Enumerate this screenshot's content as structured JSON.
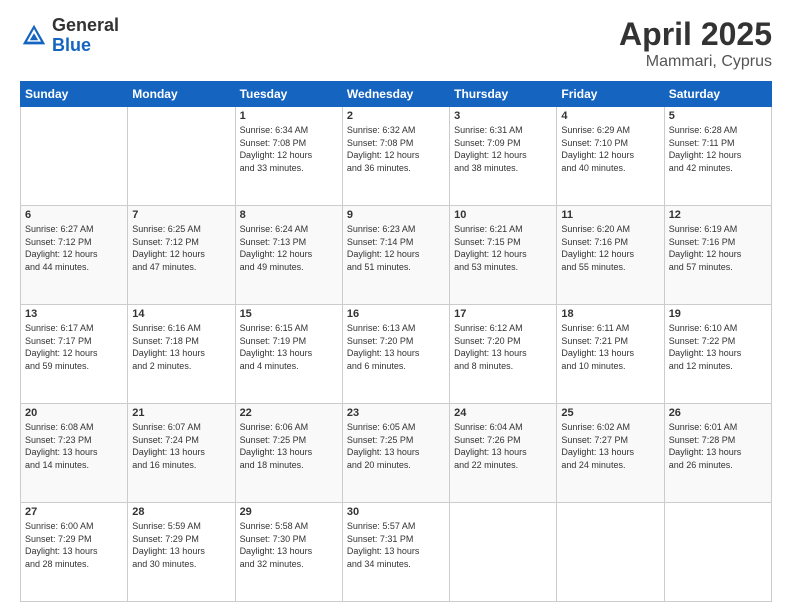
{
  "header": {
    "logo_general": "General",
    "logo_blue": "Blue",
    "month": "April 2025",
    "location": "Mammari, Cyprus"
  },
  "days_of_week": [
    "Sunday",
    "Monday",
    "Tuesday",
    "Wednesday",
    "Thursday",
    "Friday",
    "Saturday"
  ],
  "weeks": [
    [
      {
        "day": "",
        "info": ""
      },
      {
        "day": "",
        "info": ""
      },
      {
        "day": "1",
        "info": "Sunrise: 6:34 AM\nSunset: 7:08 PM\nDaylight: 12 hours\nand 33 minutes."
      },
      {
        "day": "2",
        "info": "Sunrise: 6:32 AM\nSunset: 7:08 PM\nDaylight: 12 hours\nand 36 minutes."
      },
      {
        "day": "3",
        "info": "Sunrise: 6:31 AM\nSunset: 7:09 PM\nDaylight: 12 hours\nand 38 minutes."
      },
      {
        "day": "4",
        "info": "Sunrise: 6:29 AM\nSunset: 7:10 PM\nDaylight: 12 hours\nand 40 minutes."
      },
      {
        "day": "5",
        "info": "Sunrise: 6:28 AM\nSunset: 7:11 PM\nDaylight: 12 hours\nand 42 minutes."
      }
    ],
    [
      {
        "day": "6",
        "info": "Sunrise: 6:27 AM\nSunset: 7:12 PM\nDaylight: 12 hours\nand 44 minutes."
      },
      {
        "day": "7",
        "info": "Sunrise: 6:25 AM\nSunset: 7:12 PM\nDaylight: 12 hours\nand 47 minutes."
      },
      {
        "day": "8",
        "info": "Sunrise: 6:24 AM\nSunset: 7:13 PM\nDaylight: 12 hours\nand 49 minutes."
      },
      {
        "day": "9",
        "info": "Sunrise: 6:23 AM\nSunset: 7:14 PM\nDaylight: 12 hours\nand 51 minutes."
      },
      {
        "day": "10",
        "info": "Sunrise: 6:21 AM\nSunset: 7:15 PM\nDaylight: 12 hours\nand 53 minutes."
      },
      {
        "day": "11",
        "info": "Sunrise: 6:20 AM\nSunset: 7:16 PM\nDaylight: 12 hours\nand 55 minutes."
      },
      {
        "day": "12",
        "info": "Sunrise: 6:19 AM\nSunset: 7:16 PM\nDaylight: 12 hours\nand 57 minutes."
      }
    ],
    [
      {
        "day": "13",
        "info": "Sunrise: 6:17 AM\nSunset: 7:17 PM\nDaylight: 12 hours\nand 59 minutes."
      },
      {
        "day": "14",
        "info": "Sunrise: 6:16 AM\nSunset: 7:18 PM\nDaylight: 13 hours\nand 2 minutes."
      },
      {
        "day": "15",
        "info": "Sunrise: 6:15 AM\nSunset: 7:19 PM\nDaylight: 13 hours\nand 4 minutes."
      },
      {
        "day": "16",
        "info": "Sunrise: 6:13 AM\nSunset: 7:20 PM\nDaylight: 13 hours\nand 6 minutes."
      },
      {
        "day": "17",
        "info": "Sunrise: 6:12 AM\nSunset: 7:20 PM\nDaylight: 13 hours\nand 8 minutes."
      },
      {
        "day": "18",
        "info": "Sunrise: 6:11 AM\nSunset: 7:21 PM\nDaylight: 13 hours\nand 10 minutes."
      },
      {
        "day": "19",
        "info": "Sunrise: 6:10 AM\nSunset: 7:22 PM\nDaylight: 13 hours\nand 12 minutes."
      }
    ],
    [
      {
        "day": "20",
        "info": "Sunrise: 6:08 AM\nSunset: 7:23 PM\nDaylight: 13 hours\nand 14 minutes."
      },
      {
        "day": "21",
        "info": "Sunrise: 6:07 AM\nSunset: 7:24 PM\nDaylight: 13 hours\nand 16 minutes."
      },
      {
        "day": "22",
        "info": "Sunrise: 6:06 AM\nSunset: 7:25 PM\nDaylight: 13 hours\nand 18 minutes."
      },
      {
        "day": "23",
        "info": "Sunrise: 6:05 AM\nSunset: 7:25 PM\nDaylight: 13 hours\nand 20 minutes."
      },
      {
        "day": "24",
        "info": "Sunrise: 6:04 AM\nSunset: 7:26 PM\nDaylight: 13 hours\nand 22 minutes."
      },
      {
        "day": "25",
        "info": "Sunrise: 6:02 AM\nSunset: 7:27 PM\nDaylight: 13 hours\nand 24 minutes."
      },
      {
        "day": "26",
        "info": "Sunrise: 6:01 AM\nSunset: 7:28 PM\nDaylight: 13 hours\nand 26 minutes."
      }
    ],
    [
      {
        "day": "27",
        "info": "Sunrise: 6:00 AM\nSunset: 7:29 PM\nDaylight: 13 hours\nand 28 minutes."
      },
      {
        "day": "28",
        "info": "Sunrise: 5:59 AM\nSunset: 7:29 PM\nDaylight: 13 hours\nand 30 minutes."
      },
      {
        "day": "29",
        "info": "Sunrise: 5:58 AM\nSunset: 7:30 PM\nDaylight: 13 hours\nand 32 minutes."
      },
      {
        "day": "30",
        "info": "Sunrise: 5:57 AM\nSunset: 7:31 PM\nDaylight: 13 hours\nand 34 minutes."
      },
      {
        "day": "",
        "info": ""
      },
      {
        "day": "",
        "info": ""
      },
      {
        "day": "",
        "info": ""
      }
    ]
  ]
}
